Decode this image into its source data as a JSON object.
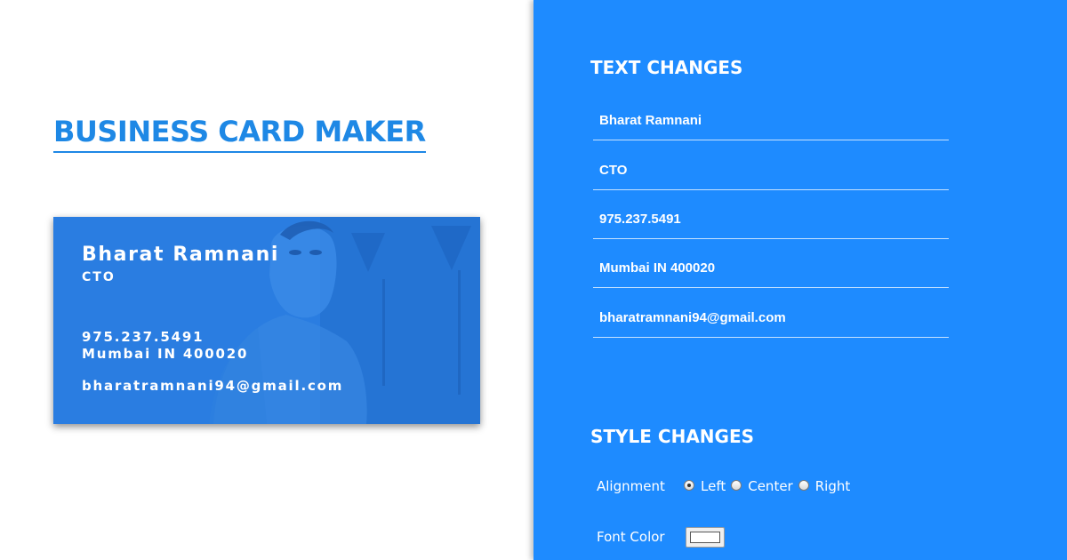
{
  "app": {
    "title": "BUSINESS CARD MAKER"
  },
  "card": {
    "name": "Bharat Ramnani",
    "title": "CTO",
    "phone": "975.237.5491",
    "address": "Mumbai IN 400020",
    "email": "bharatramnani94@gmail.com",
    "background_color": "#2a7de1",
    "text_color": "#ffffff"
  },
  "panel": {
    "background_color": "#1e8bff",
    "text_changes": {
      "heading": "TEXT CHANGES",
      "fields": [
        {
          "value": "Bharat Ramnani"
        },
        {
          "value": "CTO"
        },
        {
          "value": "975.237.5491"
        },
        {
          "value": "Mumbai IN 400020"
        },
        {
          "value": "bharatramnani94@gmail.com"
        }
      ]
    },
    "style_changes": {
      "heading": "STYLE CHANGES",
      "alignment_label": "Alignment",
      "alignment_options": [
        {
          "label": "Left",
          "checked": true
        },
        {
          "label": "Center",
          "checked": false
        },
        {
          "label": "Right",
          "checked": false
        }
      ],
      "font_color_label": "Font Color",
      "font_color_value": "#ffffff"
    }
  }
}
